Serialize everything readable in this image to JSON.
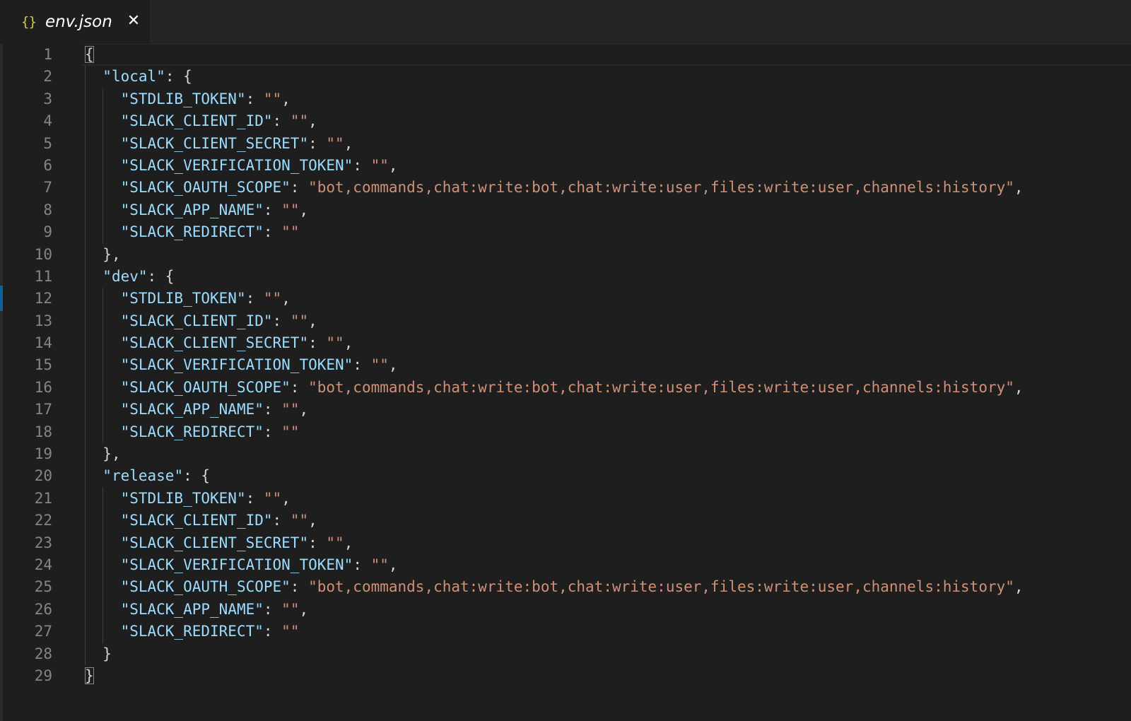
{
  "tab": {
    "icon": "{}",
    "label": "env.json",
    "close": "✕"
  },
  "editor": {
    "lines": [
      {
        "indent": 0,
        "segments": [
          {
            "t": "{",
            "c": "p"
          }
        ]
      },
      {
        "indent": 1,
        "segments": [
          {
            "t": "\"local\"",
            "c": "k"
          },
          {
            "t": ": {",
            "c": "p"
          }
        ]
      },
      {
        "indent": 2,
        "segments": [
          {
            "t": "\"STDLIB_TOKEN\"",
            "c": "k"
          },
          {
            "t": ": ",
            "c": "p"
          },
          {
            "t": "\"\"",
            "c": "s"
          },
          {
            "t": ",",
            "c": "p"
          }
        ]
      },
      {
        "indent": 2,
        "segments": [
          {
            "t": "\"SLACK_CLIENT_ID\"",
            "c": "k"
          },
          {
            "t": ": ",
            "c": "p"
          },
          {
            "t": "\"\"",
            "c": "s"
          },
          {
            "t": ",",
            "c": "p"
          }
        ]
      },
      {
        "indent": 2,
        "segments": [
          {
            "t": "\"SLACK_CLIENT_SECRET\"",
            "c": "k"
          },
          {
            "t": ": ",
            "c": "p"
          },
          {
            "t": "\"\"",
            "c": "s"
          },
          {
            "t": ",",
            "c": "p"
          }
        ]
      },
      {
        "indent": 2,
        "segments": [
          {
            "t": "\"SLACK_VERIFICATION_TOKEN\"",
            "c": "k"
          },
          {
            "t": ": ",
            "c": "p"
          },
          {
            "t": "\"\"",
            "c": "s"
          },
          {
            "t": ",",
            "c": "p"
          }
        ]
      },
      {
        "indent": 2,
        "segments": [
          {
            "t": "\"SLACK_OAUTH_SCOPE\"",
            "c": "k"
          },
          {
            "t": ": ",
            "c": "p"
          },
          {
            "t": "\"bot,commands,chat:write:bot,chat:write:user,files:write:user,channels:history\"",
            "c": "s"
          },
          {
            "t": ",",
            "c": "p"
          }
        ]
      },
      {
        "indent": 2,
        "segments": [
          {
            "t": "\"SLACK_APP_NAME\"",
            "c": "k"
          },
          {
            "t": ": ",
            "c": "p"
          },
          {
            "t": "\"\"",
            "c": "s"
          },
          {
            "t": ",",
            "c": "p"
          }
        ]
      },
      {
        "indent": 2,
        "segments": [
          {
            "t": "\"SLACK_REDIRECT\"",
            "c": "k"
          },
          {
            "t": ": ",
            "c": "p"
          },
          {
            "t": "\"\"",
            "c": "s"
          }
        ]
      },
      {
        "indent": 1,
        "segments": [
          {
            "t": "},",
            "c": "p"
          }
        ]
      },
      {
        "indent": 1,
        "segments": [
          {
            "t": "\"dev\"",
            "c": "k"
          },
          {
            "t": ": {",
            "c": "p"
          }
        ]
      },
      {
        "indent": 2,
        "segments": [
          {
            "t": "\"STDLIB_TOKEN\"",
            "c": "k"
          },
          {
            "t": ": ",
            "c": "p"
          },
          {
            "t": "\"\"",
            "c": "s"
          },
          {
            "t": ",",
            "c": "p"
          }
        ]
      },
      {
        "indent": 2,
        "segments": [
          {
            "t": "\"SLACK_CLIENT_ID\"",
            "c": "k"
          },
          {
            "t": ": ",
            "c": "p"
          },
          {
            "t": "\"\"",
            "c": "s"
          },
          {
            "t": ",",
            "c": "p"
          }
        ]
      },
      {
        "indent": 2,
        "segments": [
          {
            "t": "\"SLACK_CLIENT_SECRET\"",
            "c": "k"
          },
          {
            "t": ": ",
            "c": "p"
          },
          {
            "t": "\"\"",
            "c": "s"
          },
          {
            "t": ",",
            "c": "p"
          }
        ]
      },
      {
        "indent": 2,
        "segments": [
          {
            "t": "\"SLACK_VERIFICATION_TOKEN\"",
            "c": "k"
          },
          {
            "t": ": ",
            "c": "p"
          },
          {
            "t": "\"\"",
            "c": "s"
          },
          {
            "t": ",",
            "c": "p"
          }
        ]
      },
      {
        "indent": 2,
        "segments": [
          {
            "t": "\"SLACK_OAUTH_SCOPE\"",
            "c": "k"
          },
          {
            "t": ": ",
            "c": "p"
          },
          {
            "t": "\"bot,commands,chat:write:bot,chat:write:user,files:write:user,channels:history\"",
            "c": "s"
          },
          {
            "t": ",",
            "c": "p"
          }
        ]
      },
      {
        "indent": 2,
        "segments": [
          {
            "t": "\"SLACK_APP_NAME\"",
            "c": "k"
          },
          {
            "t": ": ",
            "c": "p"
          },
          {
            "t": "\"\"",
            "c": "s"
          },
          {
            "t": ",",
            "c": "p"
          }
        ]
      },
      {
        "indent": 2,
        "segments": [
          {
            "t": "\"SLACK_REDIRECT\"",
            "c": "k"
          },
          {
            "t": ": ",
            "c": "p"
          },
          {
            "t": "\"\"",
            "c": "s"
          }
        ]
      },
      {
        "indent": 1,
        "segments": [
          {
            "t": "},",
            "c": "p"
          }
        ]
      },
      {
        "indent": 1,
        "segments": [
          {
            "t": "\"release\"",
            "c": "k"
          },
          {
            "t": ": {",
            "c": "p"
          }
        ]
      },
      {
        "indent": 2,
        "segments": [
          {
            "t": "\"STDLIB_TOKEN\"",
            "c": "k"
          },
          {
            "t": ": ",
            "c": "p"
          },
          {
            "t": "\"\"",
            "c": "s"
          },
          {
            "t": ",",
            "c": "p"
          }
        ]
      },
      {
        "indent": 2,
        "segments": [
          {
            "t": "\"SLACK_CLIENT_ID\"",
            "c": "k"
          },
          {
            "t": ": ",
            "c": "p"
          },
          {
            "t": "\"\"",
            "c": "s"
          },
          {
            "t": ",",
            "c": "p"
          }
        ]
      },
      {
        "indent": 2,
        "segments": [
          {
            "t": "\"SLACK_CLIENT_SECRET\"",
            "c": "k"
          },
          {
            "t": ": ",
            "c": "p"
          },
          {
            "t": "\"\"",
            "c": "s"
          },
          {
            "t": ",",
            "c": "p"
          }
        ]
      },
      {
        "indent": 2,
        "segments": [
          {
            "t": "\"SLACK_VERIFICATION_TOKEN\"",
            "c": "k"
          },
          {
            "t": ": ",
            "c": "p"
          },
          {
            "t": "\"\"",
            "c": "s"
          },
          {
            "t": ",",
            "c": "p"
          }
        ]
      },
      {
        "indent": 2,
        "segments": [
          {
            "t": "\"SLACK_OAUTH_SCOPE\"",
            "c": "k"
          },
          {
            "t": ": ",
            "c": "p"
          },
          {
            "t": "\"bot,commands,chat:write:bot,chat:write:user,files:write:user,channels:history\"",
            "c": "s"
          },
          {
            "t": ",",
            "c": "p"
          }
        ]
      },
      {
        "indent": 2,
        "segments": [
          {
            "t": "\"SLACK_APP_NAME\"",
            "c": "k"
          },
          {
            "t": ": ",
            "c": "p"
          },
          {
            "t": "\"\"",
            "c": "s"
          },
          {
            "t": ",",
            "c": "p"
          }
        ]
      },
      {
        "indent": 2,
        "segments": [
          {
            "t": "\"SLACK_REDIRECT\"",
            "c": "k"
          },
          {
            "t": ": ",
            "c": "p"
          },
          {
            "t": "\"\"",
            "c": "s"
          }
        ]
      },
      {
        "indent": 1,
        "segments": [
          {
            "t": "}",
            "c": "p"
          }
        ]
      },
      {
        "indent": 0,
        "segments": [
          {
            "t": "}",
            "c": "p"
          }
        ]
      }
    ]
  },
  "colors": {
    "background": "#1e1e1e",
    "tabbar": "#252526",
    "key": "#9cdcfe",
    "string": "#ce9178",
    "punctuation": "#d4d4d4",
    "line_number": "#858585",
    "json_icon": "#cbcb41"
  }
}
